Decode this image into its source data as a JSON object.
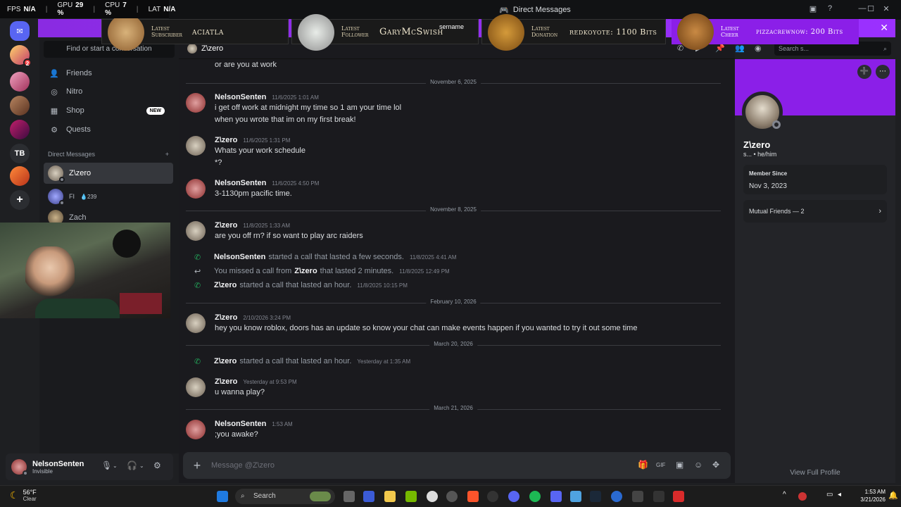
{
  "stats": {
    "fps_label": "FPS",
    "fps_value": "N/A",
    "gpu_label": "GPU",
    "gpu_value": "29 %",
    "cpu_label": "CPU",
    "cpu_value": "7 %",
    "lat_label": "LAT",
    "lat_value": "N/A"
  },
  "window": {
    "title": "Direct Messages"
  },
  "banner": {
    "subscriber_label": "Latest Subscriber",
    "subscriber_value": "aciatla",
    "follower_label": "Latest Follower",
    "follower_value": "GaryMcSwish",
    "donation_label": "Latest Donation",
    "donation_value": "redkoyote: 1100 Bits",
    "cheer_label": "Latest Cheer",
    "cheer_value": "pizzacrewnow: 200 Bits",
    "partial_text": "sername"
  },
  "rail": {
    "server_tb": "TB",
    "badge_count": "2"
  },
  "sidebar": {
    "search_placeholder": "Find or start a conversation",
    "nav": [
      {
        "label": "Friends",
        "icon": "friends-icon"
      },
      {
        "label": "Nitro",
        "icon": "nitro-icon"
      },
      {
        "label": "Shop",
        "icon": "shop-icon",
        "badge": "NEW"
      },
      {
        "label": "Quests",
        "icon": "quests-icon"
      }
    ],
    "dm_header": "Direct Messages",
    "dm_add": "+",
    "dms": [
      {
        "name": "Z\\zero"
      },
      {
        "name": "FI",
        "extra": "239"
      },
      {
        "name": "Zach"
      }
    ]
  },
  "user": {
    "name": "NelsonSenten",
    "status": "Invisible"
  },
  "chat": {
    "channel_name": "Z\\zero",
    "search_placeholder": "Search s...",
    "composer_placeholder": "Message @Z\\zero",
    "top_line": "or are you at work",
    "dividers": [
      "November 6, 2025",
      "November 8, 2025",
      "February 10, 2026",
      "March 20, 2026",
      "March 21, 2026"
    ],
    "messages": [
      {
        "author": "NelsonSenten",
        "time": "11/6/2025 1:01 AM",
        "lines": [
          "i get off work at midnight my time so 1 am your time lol",
          "when you wrote that im on my first break!"
        ]
      },
      {
        "author": "Z\\zero",
        "time": "11/6/2025 1:31 PM",
        "lines": [
          "Whats your work schedule",
          "*?"
        ]
      },
      {
        "author": "NelsonSenten",
        "time": "11/6/2025 4:50 PM",
        "lines": [
          "3-1130pm pacific time."
        ]
      },
      {
        "author": "Z\\zero",
        "time": "11/8/2025 1:33 AM",
        "lines": [
          "are you off rn? if so want to play arc raiders"
        ]
      },
      {
        "author": "Z\\zero",
        "time": "2/10/2026 3:24 PM",
        "lines": [
          "hey you know roblox, doors has an update so know your chat can make events happen if you wanted to try it out some time"
        ]
      },
      {
        "author": "Z\\zero",
        "time": "Yesterday at 9:53 PM",
        "lines": [
          "u wanna play?"
        ]
      },
      {
        "author": "NelsonSenten",
        "time": "1:53 AM",
        "lines": [
          ";you awake?"
        ]
      }
    ],
    "calls": [
      {
        "who": "NelsonSenten",
        "text": "started a call that lasted a few seconds.",
        "time": "11/8/2025 4:41 AM"
      },
      {
        "pre": "You missed a call from",
        "who": "Z\\zero",
        "text": "that lasted 2 minutes.",
        "time": "11/8/2025 12:49 PM"
      },
      {
        "who": "Z\\zero",
        "text": "started a call that lasted an hour.",
        "time": "11/8/2025 10:15 PM"
      },
      {
        "who": "Z\\zero",
        "text": "started a call that lasted an hour.",
        "time": "Yesterday at 1:35 AM"
      }
    ]
  },
  "profile": {
    "name": "Z\\zero",
    "sub_prefix": "s...",
    "pronouns": "he/him",
    "member_since_label": "Member Since",
    "member_since_value": "Nov 3, 2023",
    "mutual_friends": "Mutual Friends — 2",
    "view_full": "View Full Profile"
  },
  "taskbar": {
    "temp": "56°F",
    "condition": "Clear",
    "search": "Search",
    "time": "1:53 AM",
    "date": "3/21/2026"
  },
  "colors": {
    "accent": "#5865f2",
    "banner": "#8b1fe8",
    "online_call": "#23a55a"
  }
}
